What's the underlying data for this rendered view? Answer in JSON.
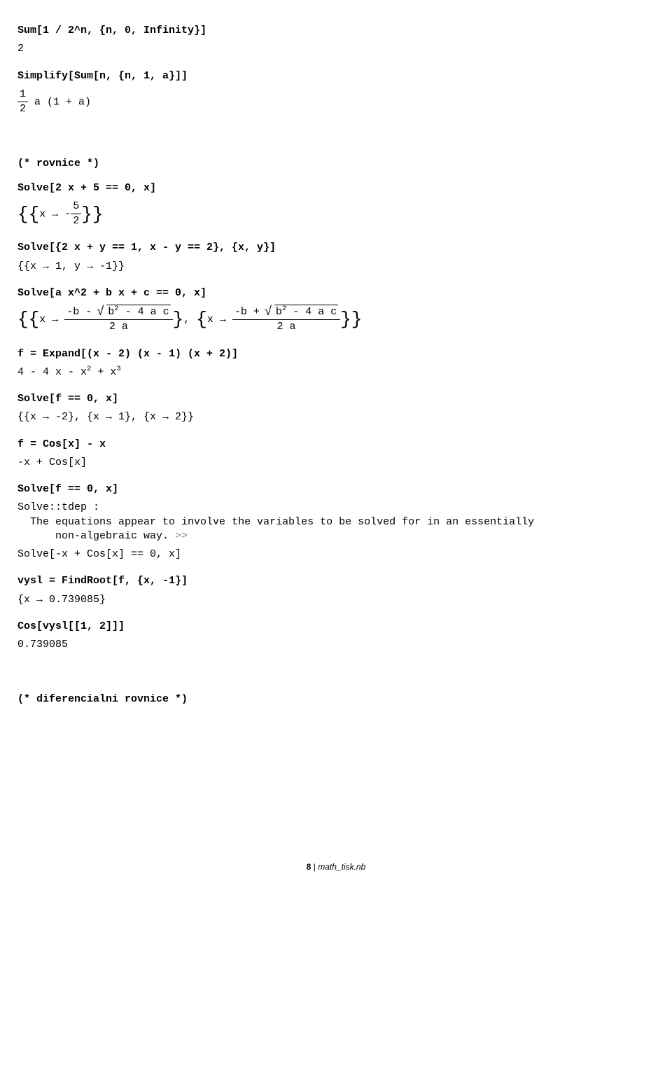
{
  "lines": {
    "in1": "Sum[1 / 2^n, {n, 0, Infinity}]",
    "out1": "2",
    "in2": "Simplify[Sum[n, {n, 1, a}]]",
    "out2_frac_num": "1",
    "out2_frac_den": "2",
    "out2_rest": " a (1 + a)",
    "comment1": "(* rovnice *)",
    "in3": "Solve[2 x + 5 == 0, x]",
    "out3_prefix": "x → -",
    "out3_num": "5",
    "out3_den": "2",
    "in4": "Solve[{2 x + y == 1, x - y == 2}, {x, y}]",
    "out4": "{{x → 1, y → -1}}",
    "in5": "Solve[a x^2 + b x + c == 0, x]",
    "out5_x1": "x → ",
    "out5_num1_a": "-b - ",
    "out5_rad1": "b",
    "out5_rad1b": " - 4 a c",
    "out5_den1": "2 a",
    "out5_sep": ", ",
    "out5_x2": "x → ",
    "out5_num2_a": "-b + ",
    "out5_rad2": "b",
    "out5_rad2b": " - 4 a c",
    "out5_den2": "2 a",
    "in6": "f = Expand[(x - 2) (x - 1) (x + 2)]",
    "out6_a": "4 - 4 x - x",
    "out6_b": " + x",
    "in7": "Solve[f == 0, x]",
    "out7": "{{x → -2}, {x → 1}, {x → 2}}",
    "in8": "f = Cos[x] - x",
    "out8": "-x + Cos[x]",
    "in9": "Solve[f == 0, x]",
    "msg1": "Solve::tdep :\n  The equations appear to involve the variables to be solved for in an essentially\n      non-algebraic way. ",
    "msg1_gg": ">>",
    "out9": "Solve[-x + Cos[x] == 0, x]",
    "in10": "vysl = FindRoot[f, {x, -1}]",
    "out10": "{x → 0.739085}",
    "in11": "Cos[vysl[[1, 2]]]",
    "out11": "0.739085",
    "comment2": "(* diferencialni rovnice *)"
  },
  "footer": {
    "page": "8",
    "sep": " | ",
    "file": "math_tisk.nb"
  }
}
